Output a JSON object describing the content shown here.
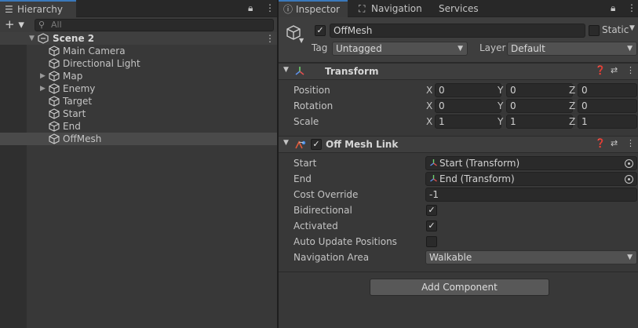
{
  "hierarchy": {
    "tab_label": "Hierarchy",
    "plus_label": "+ ▾",
    "search_placeholder": "All",
    "scene_name": "Scene 2",
    "items": [
      {
        "label": "Main Camera"
      },
      {
        "label": "Directional Light"
      },
      {
        "label": "Map",
        "expandable": true
      },
      {
        "label": "Enemy",
        "expandable": true
      },
      {
        "label": "Target"
      },
      {
        "label": "Start"
      },
      {
        "label": "End"
      },
      {
        "label": "OffMesh",
        "selected": true
      }
    ]
  },
  "inspector": {
    "tabs": [
      "Inspector",
      "Navigation",
      "Services"
    ],
    "object": {
      "name": "OffMesh",
      "static_label": "Static",
      "tag_label": "Tag",
      "tag_value": "Untagged",
      "layer_label": "Layer",
      "layer_value": "Default"
    },
    "transform": {
      "title": "Transform",
      "rows": [
        {
          "label": "Position",
          "x": "0",
          "y": "0",
          "z": "0"
        },
        {
          "label": "Rotation",
          "x": "0",
          "y": "0",
          "z": "0"
        },
        {
          "label": "Scale",
          "x": "1",
          "y": "1",
          "z": "1"
        }
      ],
      "axis_labels": [
        "X",
        "Y",
        "Z"
      ]
    },
    "off_mesh_link": {
      "title": "Off Mesh Link",
      "start_label": "Start",
      "start_value": "Start (Transform)",
      "end_label": "End",
      "end_value": "End (Transform)",
      "cost_label": "Cost Override",
      "cost_value": "-1",
      "bidirectional_label": "Bidirectional",
      "activated_label": "Activated",
      "auto_update_label": "Auto Update Positions",
      "nav_area_label": "Navigation Area",
      "nav_area_value": "Walkable"
    },
    "add_component_label": "Add Component"
  },
  "colors": {
    "tab_accent": "#3a79bb",
    "panel_bg": "#383838",
    "selected_row": "#4a4a4a"
  }
}
